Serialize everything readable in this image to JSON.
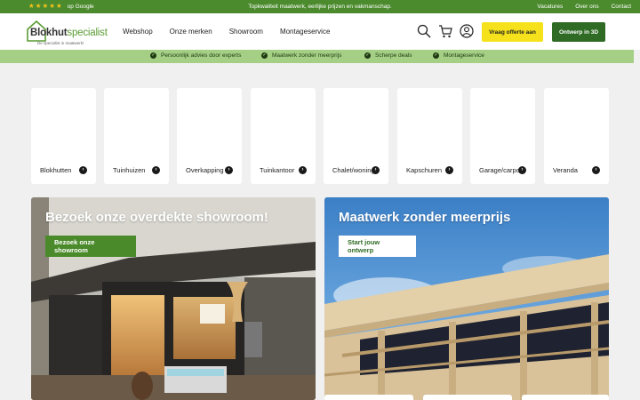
{
  "topbar": {
    "google": "op Google",
    "tagline": "Topkwaliteit maatwerk, eerlijke prijzen en vakmanschap.",
    "links": [
      "Vacatures",
      "Over ons",
      "Contact"
    ]
  },
  "header": {
    "brand_part1": "Blokhut",
    "brand_part2": "specialist",
    "brand_sub": "De specialist in maatwerk!",
    "nav": [
      "Webshop",
      "Onze merken",
      "Showroom",
      "Montageservice"
    ],
    "quote_button": "Vraag offerte aan",
    "design_button": "Ontwerp in 3D"
  },
  "usp": [
    "Persoonlijk advies door experts",
    "Maatwerk zonder meerprijs",
    "Scherpe deals",
    "Montageservice"
  ],
  "categories": [
    "Blokhutten",
    "Tuinhuizen",
    "Overkapping",
    "Tuinkantoor",
    "Chalet/woning",
    "Kapschuren",
    "Garage/carport",
    "Veranda"
  ],
  "banners": {
    "showroom": {
      "title": "Bezoek onze overdekte showroom!",
      "cta": "Bezoek onze showroom"
    },
    "maatwerk": {
      "title": "Maatwerk zonder meerprijs",
      "cta": "Start jouw ontwerp"
    }
  },
  "colors": {
    "topbar_green": "#4c8a2e",
    "usp_green": "#a4cf85",
    "quote_yellow": "#f5e21c",
    "design_green": "#2f6b25"
  }
}
